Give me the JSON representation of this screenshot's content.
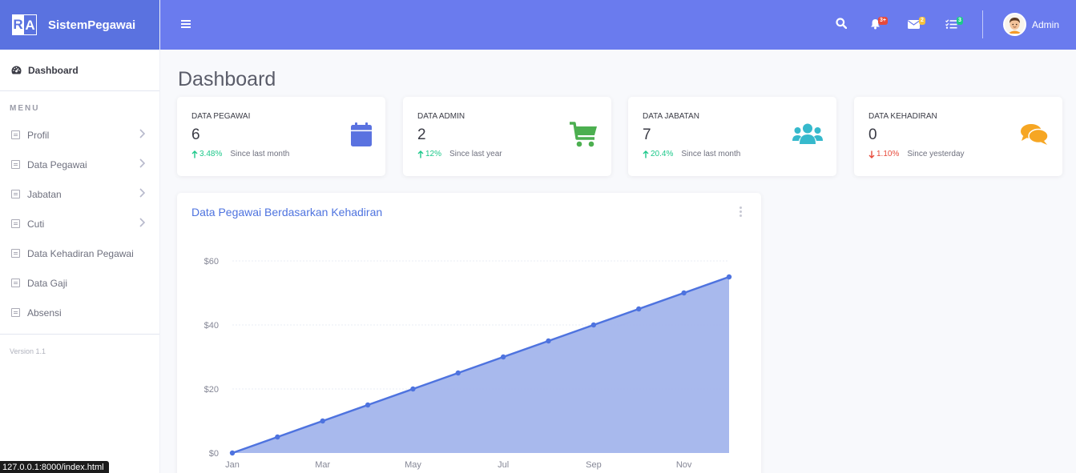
{
  "brand": {
    "logo_left": "R",
    "logo_right": "A",
    "name": "SistemPegawai"
  },
  "sidebar": {
    "dashboard_label": "Dashboard",
    "menu_heading": "MENU",
    "items": [
      {
        "label": "Profil",
        "has_chevron": true
      },
      {
        "label": "Data Pegawai",
        "has_chevron": true
      },
      {
        "label": "Jabatan",
        "has_chevron": true
      },
      {
        "label": "Cuti",
        "has_chevron": true
      },
      {
        "label": "Data Kehadiran Pegawai",
        "has_chevron": false
      },
      {
        "label": "Data Gaji",
        "has_chevron": false
      },
      {
        "label": "Absensi",
        "has_chevron": false
      }
    ],
    "version": "Version 1.1"
  },
  "topbar": {
    "alerts_badge": "3+",
    "messages_badge": "2",
    "tasks_badge": "3",
    "user_name": "Admin"
  },
  "status_url": "127.0.0.1:8000/index.html",
  "page_title": "Dashboard",
  "cards": [
    {
      "title": "DATA PEGAWAI",
      "value": "6",
      "trend": "up",
      "pct": "3.48%",
      "since": "Since last month",
      "icon": "calendar-icon",
      "color": "#5a72e0"
    },
    {
      "title": "DATA ADMIN",
      "value": "2",
      "trend": "up",
      "pct": "12%",
      "since": "Since last year",
      "icon": "cart-icon",
      "color": "#4caf50"
    },
    {
      "title": "DATA JABATAN",
      "value": "7",
      "trend": "up",
      "pct": "20.4%",
      "since": "Since last month",
      "icon": "users-icon",
      "color": "#36b9cc"
    },
    {
      "title": "DATA KEHADIRAN",
      "value": "0",
      "trend": "down",
      "pct": "1.10%",
      "since": "Since yesterday",
      "icon": "comments-icon",
      "color": "#f6a623"
    }
  ],
  "chart": {
    "title": "Data Pegawai Berdasarkan Kehadiran"
  },
  "chart_data": {
    "type": "area",
    "title": "Data Pegawai Berdasarkan Kehadiran",
    "x": [
      "Jan",
      "Feb",
      "Mar",
      "Apr",
      "May",
      "Jun",
      "Jul",
      "Aug",
      "Sep",
      "Oct",
      "Nov",
      "Dec"
    ],
    "x_tick_labels": [
      "Jan",
      "Mar",
      "May",
      "Jul",
      "Sep",
      "Nov"
    ],
    "values": [
      0,
      5,
      10,
      15,
      20,
      25,
      30,
      35,
      40,
      45,
      50,
      55
    ],
    "y_ticks": [
      "$0",
      "$20",
      "$40",
      "$60"
    ],
    "ylim": [
      0,
      60
    ],
    "grid": true,
    "line_color": "#4e73df",
    "fill_color": "#a3b5ec"
  }
}
